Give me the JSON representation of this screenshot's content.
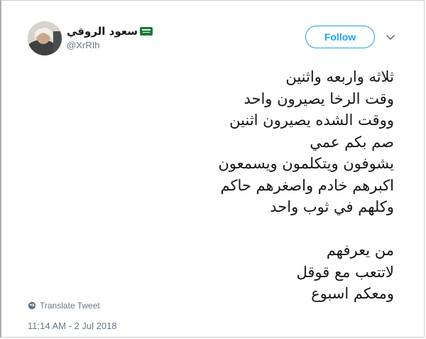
{
  "user": {
    "display_name": "سعود الروقي",
    "handle": "@XrRIh",
    "flag_icon": "saudi-flag-icon"
  },
  "header": {
    "follow_label": "Follow",
    "menu_icon": "chevron-down-icon"
  },
  "tweet": {
    "lines": [
      "ثلاثه واربعه واثنين",
      "وقت الرخا يصيرون واحد",
      "ووقت الشده يصيرون اثنين",
      "صم بكم عمي",
      "يشوفون ويتكلمون ويسمعون",
      "اكبرهم خادم واصغرهم حاكم",
      "وكلهم في ثوب واحد",
      "",
      "من يعرفهم",
      "لاتتعب مع قوقل",
      "ومعكم اسبوع"
    ],
    "translate_label": "Translate Tweet",
    "timestamp": "11:14 AM - 2 Jul 2018"
  },
  "colors": {
    "accent": "#1da1f2",
    "muted": "#657786",
    "text": "#14171a"
  }
}
